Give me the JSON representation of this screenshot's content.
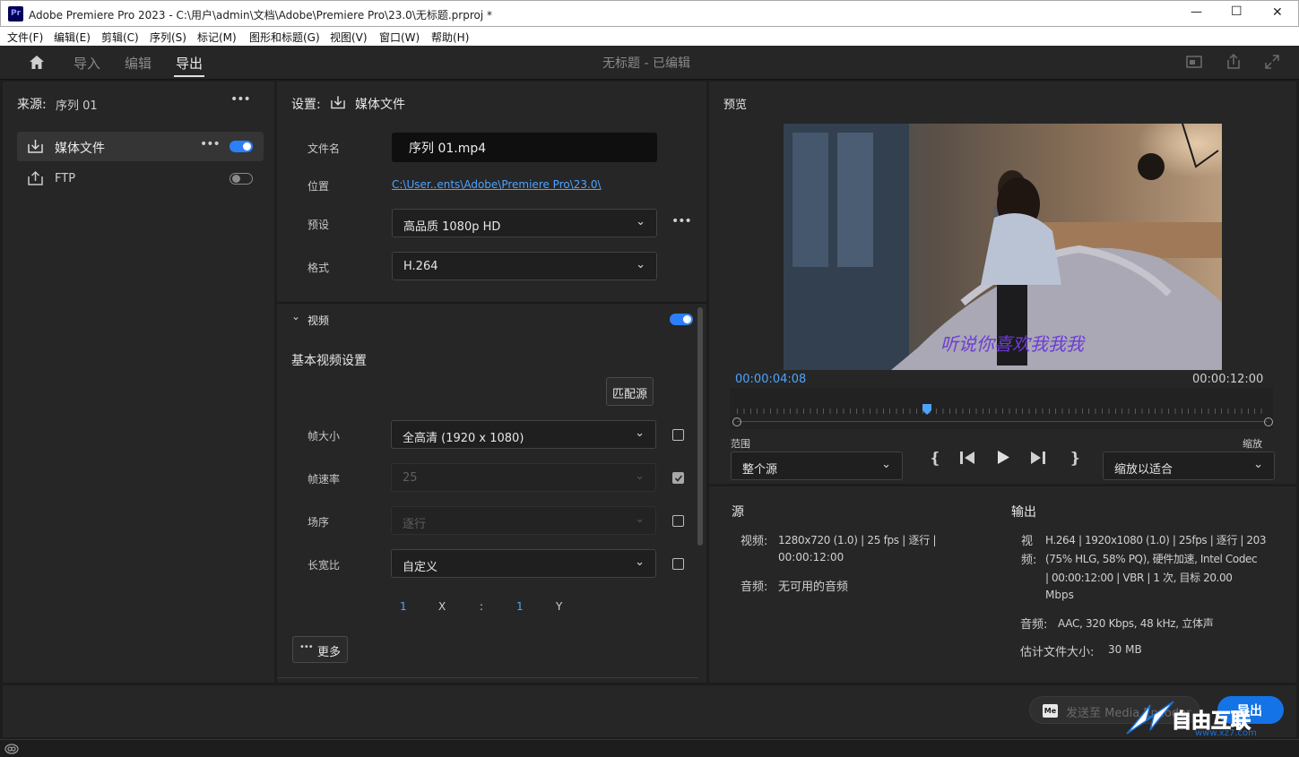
{
  "window": {
    "app_icon": "Pr",
    "title": "Adobe Premiere Pro 2023 - C:\\用户\\admin\\文档\\Adobe\\Premiere Pro\\23.0\\无标题.prproj *",
    "minimize": "—",
    "maximize": "☐",
    "close": "✕"
  },
  "menu": [
    "文件(F)",
    "编辑(E)",
    "剪辑(C)",
    "序列(S)",
    "标记(M)",
    "图形和标题(G)",
    "视图(V)",
    "窗口(W)",
    "帮助(H)"
  ],
  "topbar": {
    "tabs": [
      "导入",
      "编辑",
      "导出"
    ],
    "active_tab": "导出",
    "project_status": "无标题 - 已编辑"
  },
  "source": {
    "label": "来源:",
    "sequence": "序列 01",
    "destinations": [
      {
        "label": "媒体文件",
        "enabled": true,
        "icon": "download-icon"
      },
      {
        "label": "FTP",
        "enabled": false,
        "icon": "upload-icon"
      }
    ]
  },
  "settings": {
    "label": "设置:",
    "target": "媒体文件",
    "filename_label": "文件名",
    "filename": "序列 01.mp4",
    "location_label": "位置",
    "location": "C:\\User..ents\\Adobe\\Premiere Pro\\23.0\\",
    "preset_label": "预设",
    "preset": "高品质 1080p HD",
    "format_label": "格式",
    "format": "H.264"
  },
  "video": {
    "section": "视频",
    "enabled": true,
    "basic_title": "基本视频设置",
    "match_source": "匹配源",
    "frame_size_label": "帧大小",
    "frame_size": "全高清 (1920 x 1080)",
    "frame_size_checked": false,
    "frame_rate_label": "帧速率",
    "frame_rate": "25",
    "frame_rate_checked": true,
    "field_order_label": "场序",
    "field_order": "逐行",
    "field_order_checked": false,
    "aspect_label": "长宽比",
    "aspect": "自定义",
    "aspect_checked": false,
    "ratio_x_val": "1",
    "ratio_x": "X",
    "ratio_sep": ":",
    "ratio_y_val": "1",
    "ratio_y": "Y",
    "more": "更多"
  },
  "preview": {
    "title": "预览",
    "subtitle": "听说你喜欢我我我",
    "current_time": "00:00:04:08",
    "duration": "00:00:12:00",
    "playhead_fraction": 0.36,
    "range_label": "范围",
    "range": "整个源",
    "zoom_label": "缩放",
    "zoom": "缩放以适合"
  },
  "source_info": {
    "title": "源",
    "video_label": "视频:",
    "video": "1280x720 (1.0) | 25 fps | 逐行 |",
    "video_duration": "00:00:12:00",
    "audio_label": "音频:",
    "audio": "无可用的音频"
  },
  "output_info": {
    "title": "输出",
    "video_label_1": "视",
    "video_label_2": "频:",
    "video_lines": [
      "H.264 | 1920x1080 (1.0) | 25fps | 逐行 | 203",
      "(75% HLG, 58% PQ), 硬件加速, Intel Codec",
      "| 00:00:12:00 | VBR | 1 次, 目标 20.00",
      "Mbps"
    ],
    "audio_label": "音频:",
    "audio": "AAC, 320 Kbps, 48 kHz, 立体声",
    "size_label": "估计文件大小:",
    "size": "30 MB"
  },
  "footer": {
    "send_me_badge": "Me",
    "send_me": "发送至 Media Encoder",
    "export": "导出",
    "watermark": "自由互联",
    "watermark_url": "www.xz7.com"
  },
  "colors": {
    "accent": "#2d7ff9",
    "link": "#4ea3ff",
    "panel": "#262626"
  }
}
